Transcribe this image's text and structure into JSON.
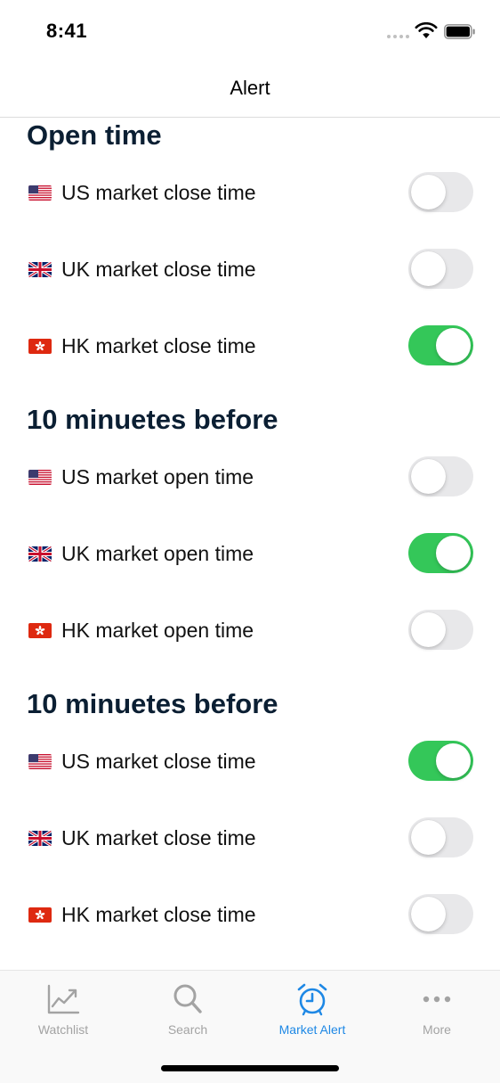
{
  "status_bar": {
    "time": "8:41"
  },
  "nav": {
    "title": "Alert"
  },
  "colors": {
    "toggle_on": "#34c759",
    "toggle_off": "#e8e8ea",
    "accent": "#1e88e5",
    "section_header": "#0b1f33"
  },
  "sections": [
    {
      "title": "Open time",
      "rows": [
        {
          "flag": "us-flag-icon",
          "label": "US market close time",
          "enabled": false
        },
        {
          "flag": "uk-flag-icon",
          "label": "UK market close time",
          "enabled": false
        },
        {
          "flag": "hk-flag-icon",
          "label": "HK market close time",
          "enabled": true
        }
      ]
    },
    {
      "title": "10 minuetes before",
      "rows": [
        {
          "flag": "us-flag-icon",
          "label": "US market open time",
          "enabled": false
        },
        {
          "flag": "uk-flag-icon",
          "label": "UK market open time",
          "enabled": true
        },
        {
          "flag": "hk-flag-icon",
          "label": "HK market open time",
          "enabled": false
        }
      ]
    },
    {
      "title": "10 minuetes before",
      "rows": [
        {
          "flag": "us-flag-icon",
          "label": "US market close time",
          "enabled": true
        },
        {
          "flag": "uk-flag-icon",
          "label": "UK market close time",
          "enabled": false
        },
        {
          "flag": "hk-flag-icon",
          "label": "HK market close time",
          "enabled": false
        }
      ]
    }
  ],
  "tabs": [
    {
      "label": "Watchlist",
      "icon": "chart-line-icon",
      "active": false
    },
    {
      "label": "Search",
      "icon": "magnifier-icon",
      "active": false
    },
    {
      "label": "Market Alert",
      "icon": "alarm-clock-icon",
      "active": true
    },
    {
      "label": "More",
      "icon": "ellipsis-icon",
      "active": false
    }
  ]
}
